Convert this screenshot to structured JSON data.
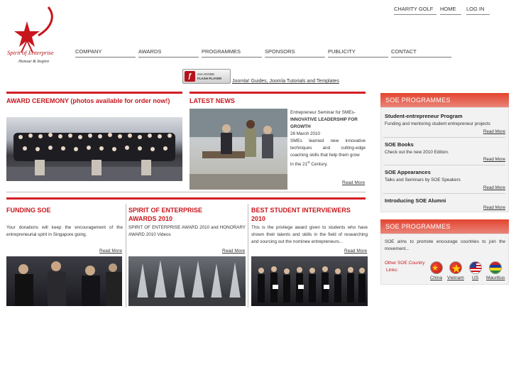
{
  "top_links": {
    "charity_golf": "CHARITY GOLF",
    "home": "HOME",
    "login": "LOG IN"
  },
  "logo": {
    "name": "Spirit of Enterprise",
    "tagline": "Honour & Inspire"
  },
  "nav": [
    "COMPANY",
    "AWARDS",
    "PROGRAMMES",
    "SPONSORS",
    "PUBLICITY",
    "CONTACT"
  ],
  "flash_badge": {
    "line1": "Get ADOBE",
    "line2": "FLASH PLAYER"
  },
  "joomla_link": "Joomla! Guides, Joomla Tutorials and Templates",
  "award_ceremony": {
    "title": "AWARD CEREMONY (photos available for order now!)"
  },
  "latest_news": {
    "title": "LATEST NEWS",
    "intro": "Entrepreneur Seminar for SMEs-",
    "headline1": "INNOVATIVE LEADERSHIP FOR",
    "headline2": "GROWTH",
    "date": "26 March 2010",
    "body1": "SMEs learned new innovative",
    "body2": "techniques and cutting-edge",
    "body3": "coaching skills that help them grow",
    "body4_pre": "in the 21",
    "body4_sup": "st",
    "body4_post": " Century.",
    "read_more": "Read More"
  },
  "funding": {
    "title": "FUNDING SOE",
    "body": "Your donations will keep the encouragement of the entrepreneurial spirit in Singapore going.",
    "read_more": "Read More"
  },
  "awards2010": {
    "title1": "SPIRIT OF ENTERPRISE",
    "title2": "AWARDS 2010",
    "body": "SPIRIT OF ENTERPRISE AWARD 2010 and HONORARY AWARD 2010 Videos",
    "read_more": "Read More"
  },
  "interviewers": {
    "title1": "BEST STUDENT INTERVIEWERS",
    "title2": "2010",
    "body": "This is the privilege award given to students who have shown their talents and skills in the field of researching and sourcing out the nominee entrepreneurs...",
    "read_more": "Read More"
  },
  "sidebar": {
    "programmes_head": "SOE PROGRAMMES",
    "items": [
      {
        "title": "Student-entrepreneur Program",
        "desc": "Funding and mentoring student entrepreneur projects",
        "more": "Read More"
      },
      {
        "title": "SOE Books",
        "desc": "Check out the new 2010 Edition.",
        "more": "Read More"
      },
      {
        "title": "SOE Appearances",
        "desc": "Talks and Seminars by SOE Speakers",
        "more": "Read More"
      },
      {
        "title": "Introducing SOE Alumni",
        "desc": "",
        "more": "Read More"
      }
    ],
    "programmes_head2": "SOE PROGRAMMES",
    "aim": "SOE aims to promote encourage countries to join the movement...",
    "other_label1": "Other SOE Country",
    "other_label2": "Links:",
    "countries": [
      "China",
      "Vietnam",
      "US",
      "Mauritius"
    ]
  }
}
